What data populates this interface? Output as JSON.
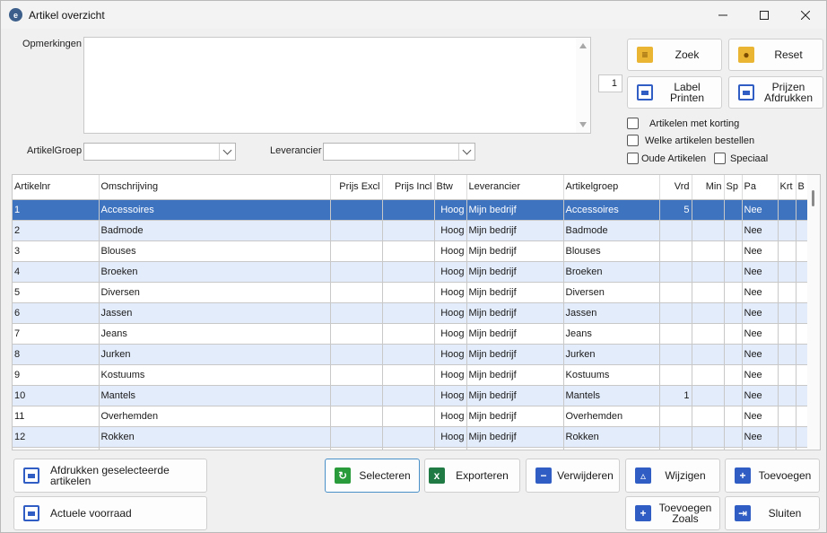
{
  "window": {
    "title": "Artikel overzicht",
    "min_icon": "minimize-icon",
    "max_icon": "maximize-icon",
    "close_icon": "close-icon"
  },
  "form": {
    "opmerkingen_label": "Opmerkingen",
    "opmerkingen_value": "",
    "artikelgroep_label": "ArtikelGroep",
    "artikelgroep_value": "",
    "leverancier_label": "Leverancier",
    "leverancier_value": "",
    "number_value": "1"
  },
  "top_buttons": {
    "zoek": "Zoek",
    "reset": "Reset",
    "label_printen_1": "Label",
    "label_printen_2": "Printen",
    "prijzen_1": "Prijzen",
    "prijzen_2": "Afdrukken"
  },
  "checkboxes": {
    "korting": "Artikelen met korting",
    "bestellen": "Welke artikelen bestellen",
    "oude": "Oude Artikelen",
    "speciaal": "Speciaal"
  },
  "table": {
    "columns": [
      "Artikelnr",
      "Omschrijving",
      "Prijs Excl",
      "Prijs Incl",
      "Btw",
      "Leverancier",
      "Artikelgroep",
      "Vrd",
      "Min",
      "Sp",
      "Pa",
      "Krt",
      "B"
    ],
    "rows": [
      [
        "1",
        "Accessoires",
        "",
        "",
        "Hoog",
        "Mijn bedrijf",
        "Accessoires",
        "5",
        "",
        "",
        "Nee",
        "",
        ""
      ],
      [
        "2",
        "Badmode",
        "",
        "",
        "Hoog",
        "Mijn bedrijf",
        "Badmode",
        "",
        "",
        "",
        "Nee",
        "",
        ""
      ],
      [
        "3",
        "Blouses",
        "",
        "",
        "Hoog",
        "Mijn bedrijf",
        "Blouses",
        "",
        "",
        "",
        "Nee",
        "",
        ""
      ],
      [
        "4",
        "Broeken",
        "",
        "",
        "Hoog",
        "Mijn bedrijf",
        "Broeken",
        "",
        "",
        "",
        "Nee",
        "",
        ""
      ],
      [
        "5",
        "Diversen",
        "",
        "",
        "Hoog",
        "Mijn bedrijf",
        "Diversen",
        "",
        "",
        "",
        "Nee",
        "",
        ""
      ],
      [
        "6",
        "Jassen",
        "",
        "",
        "Hoog",
        "Mijn bedrijf",
        "Jassen",
        "",
        "",
        "",
        "Nee",
        "",
        ""
      ],
      [
        "7",
        "Jeans",
        "",
        "",
        "Hoog",
        "Mijn bedrijf",
        "Jeans",
        "",
        "",
        "",
        "Nee",
        "",
        ""
      ],
      [
        "8",
        "Jurken",
        "",
        "",
        "Hoog",
        "Mijn bedrijf",
        "Jurken",
        "",
        "",
        "",
        "Nee",
        "",
        ""
      ],
      [
        "9",
        "Kostuums",
        "",
        "",
        "Hoog",
        "Mijn bedrijf",
        "Kostuums",
        "",
        "",
        "",
        "Nee",
        "",
        ""
      ],
      [
        "10",
        "Mantels",
        "",
        "",
        "Hoog",
        "Mijn bedrijf",
        "Mantels",
        "1",
        "",
        "",
        "Nee",
        "",
        ""
      ],
      [
        "11",
        "Overhemden",
        "",
        "",
        "Hoog",
        "Mijn bedrijf",
        "Overhemden",
        "",
        "",
        "",
        "Nee",
        "",
        ""
      ],
      [
        "12",
        "Rokken",
        "",
        "",
        "Hoog",
        "Mijn bedrijf",
        "Rokken",
        "",
        "",
        "",
        "Nee",
        "",
        ""
      ],
      [
        "",
        "",
        "",
        "",
        "",
        "",
        "",
        "",
        "",
        "",
        "",
        "",
        ""
      ]
    ],
    "selected_row": 0
  },
  "bottom_buttons": {
    "afdrukken_sel": "Afdrukken geselecteerde artikelen",
    "actuele": "Actuele voorraad",
    "selecteren": "Selecteren",
    "exporteren": "Exporteren",
    "verwijderen": "Verwijderen",
    "wijzigen": "Wijzigen",
    "toevoegen": "Toevoegen",
    "toevoegen_zoals_1": "Toevoegen",
    "toevoegen_zoals_2": "Zoals",
    "sluiten": "Sluiten"
  },
  "colors": {
    "selection": "#3e73c0",
    "alt_row": "#e3ecfb",
    "accent_blue": "#2f5dc4"
  }
}
